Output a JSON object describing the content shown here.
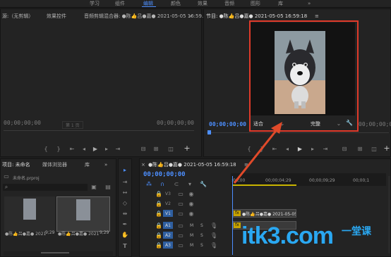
{
  "workspace_tabs": {
    "t0": "学习",
    "t1": "组件",
    "t2": "编辑",
    "t3": "颜色",
    "t4": "效果",
    "t5": "音频",
    "t6": "图形",
    "t7": "库",
    "more": "»"
  },
  "source_panel": {
    "tab_source": "源:（无剪辑）",
    "tab_effects": "效果控件",
    "tab_audio_mixer": "音频剪辑混合器: ●陈👍吕●嘉● 2021-05-05 16:59...",
    "more": "»",
    "timecode_left": "00;00;00;00",
    "page": "第 1 页",
    "timecode_right": "00;00;00;00"
  },
  "program_panel": {
    "title": "节目: ●陈👍吕●嘉● 2021-05-05 16:59:18",
    "menu": "≡",
    "timecode": "00;00;00;00",
    "fit": "适合",
    "quality": "完整",
    "end_timecode": "00;00;00;00"
  },
  "project_panel": {
    "tab_project": "项目: 未命名",
    "tab_media_browser": "媒体浏览器",
    "tab_library": "库",
    "more": "»",
    "file": "未命名.prproj",
    "item1_name": "●陈👍吕●嘉● 2021",
    "item1_duration": "9;29",
    "item2_name": "●陈👍吕●嘉● 2021",
    "item2_duration": "9;29"
  },
  "timeline": {
    "tab_close": "×",
    "title": "●陈👍吕●嘉● 2021-05-05 16:59:18",
    "menu": "≡",
    "timecode": "00;00;00;00",
    "ruler": {
      "r0": ":00;00",
      "r1": "00;00;04;29",
      "r2": "00;00;09;29",
      "r3": "00;00;1"
    },
    "tracks": {
      "v3": "V3",
      "v2": "V2",
      "v1": "V1",
      "a1": "A1",
      "a2": "A2",
      "a3": "A3",
      "m": "M",
      "s": "S"
    },
    "clip_label": "●陈👍吕●嘉● 2021-05-05 16:59:18",
    "fx": "fx"
  },
  "watermark": "itk3.com",
  "watermark_sub": "一堂课",
  "colors": {
    "accent": "#4d8fff",
    "highlight": "#e03a2a",
    "panel": "#232323",
    "arrow": "#e04a2a"
  }
}
